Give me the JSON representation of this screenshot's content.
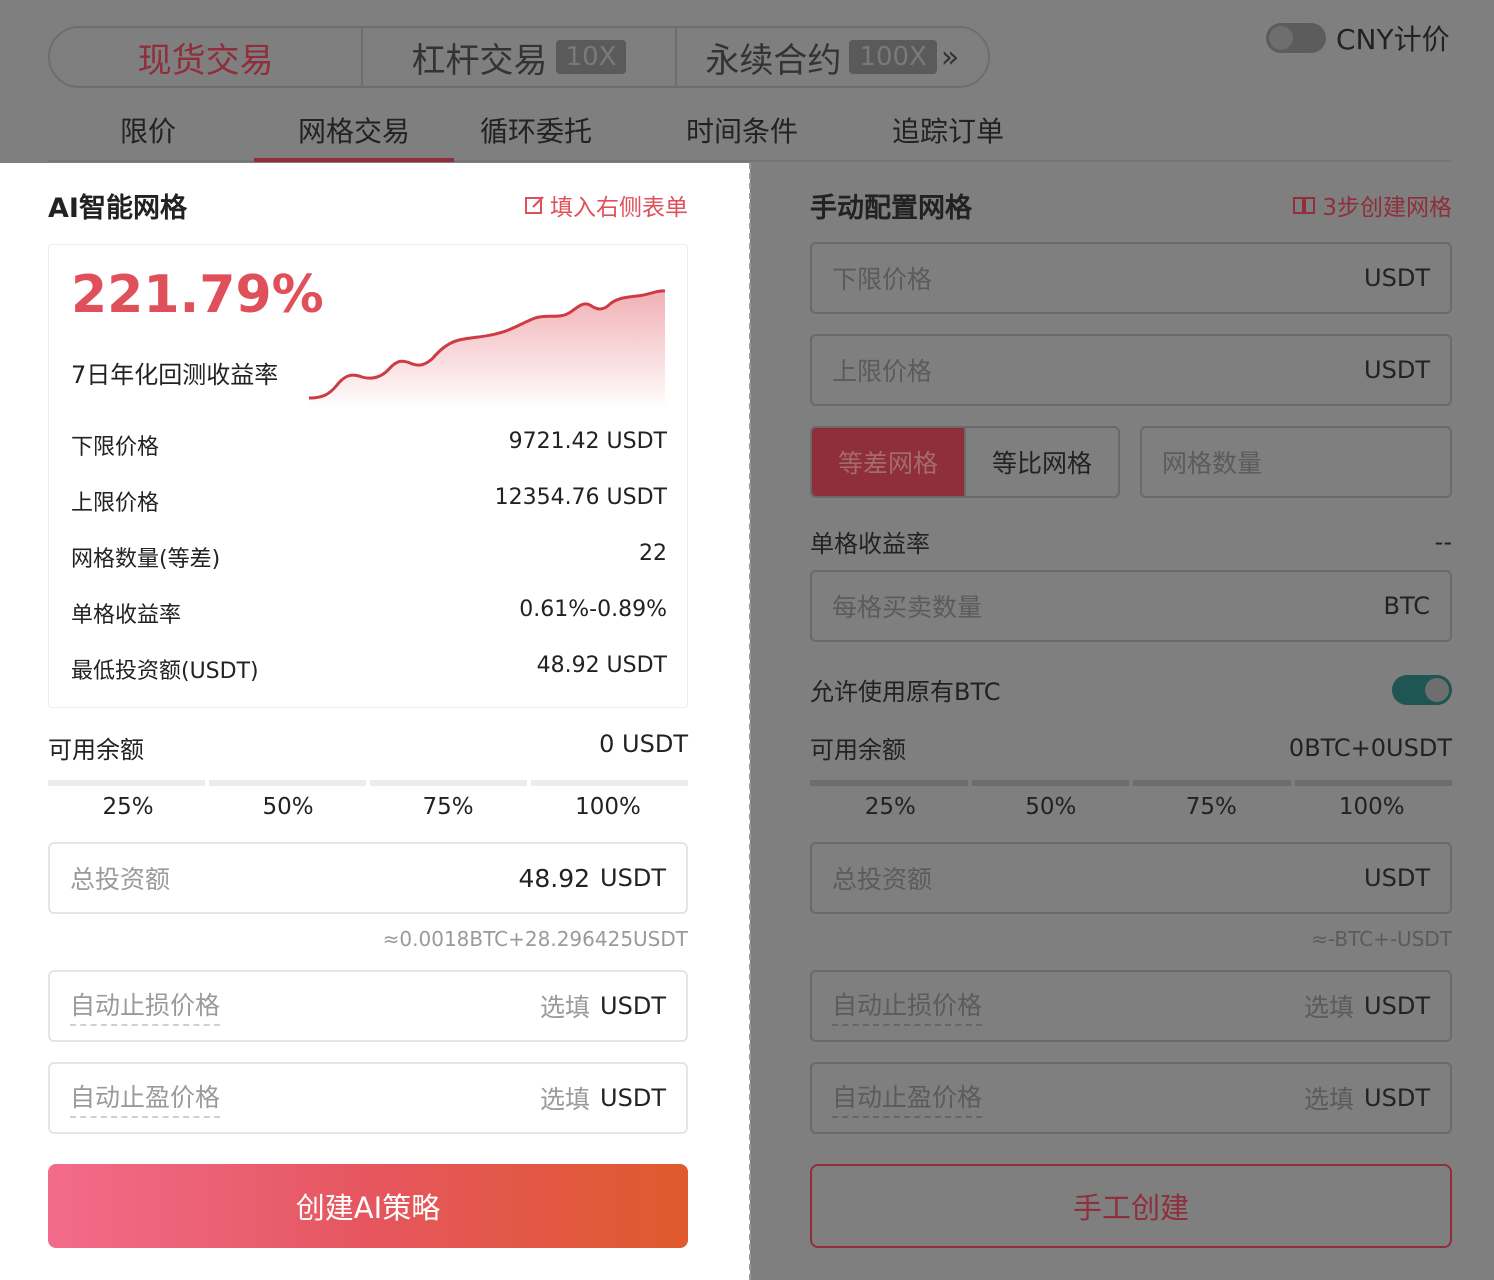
{
  "mode_tabs": [
    {
      "label": "现货交易",
      "badge": ""
    },
    {
      "label": "杠杆交易",
      "badge": "10X"
    },
    {
      "label": "永续合约",
      "badge": "100X"
    }
  ],
  "mode_more": "»",
  "cny_label": "CNY计价",
  "sub_tabs": [
    "限价",
    "网格交易",
    "循环委托",
    "时间条件",
    "追踪订单"
  ],
  "ai": {
    "title": "AI智能网格",
    "fill_link": "填入右侧表单",
    "yield": "221.79%",
    "yield_label": "7日年化回测收益率",
    "rows": [
      {
        "label": "下限价格",
        "value": "9721.42 USDT"
      },
      {
        "label": "上限价格",
        "value": "12354.76 USDT"
      },
      {
        "label": "网格数量(等差)",
        "value": "22"
      },
      {
        "label": "单格收益率",
        "value": "0.61%-0.89%"
      },
      {
        "label": "最低投资额(USDT)",
        "value": "48.92 USDT"
      }
    ],
    "avail_label": "可用余额",
    "avail_value": "0 USDT",
    "pcts": [
      "25%",
      "50%",
      "75%",
      "100%"
    ],
    "invest_ph": "总投资额",
    "invest_value": "48.92",
    "unit": "USDT",
    "approx": "≈0.0018BTC+28.296425USDT",
    "stop_loss": "自动止损价格",
    "take_profit": "自动止盈价格",
    "optional": "选填",
    "create": "创建AI策略"
  },
  "manual": {
    "title": "手动配置网格",
    "guide_link": "3步创建网格",
    "lower_ph": "下限价格",
    "upper_ph": "上限价格",
    "unit": "USDT",
    "grid_arith": "等差网格",
    "grid_geo": "等比网格",
    "grid_count_ph": "网格数量",
    "per_grid_label": "单格收益率",
    "per_grid_value": "--",
    "qty_ph": "每格买卖数量",
    "qty_unit": "BTC",
    "allow_label": "允许使用原有BTC",
    "avail_label": "可用余额",
    "avail_value": "0BTC+0USDT",
    "pcts": [
      "25%",
      "50%",
      "75%",
      "100%"
    ],
    "invest_ph": "总投资额",
    "approx": "≈-BTC+-USDT",
    "stop_loss": "自动止损价格",
    "take_profit": "自动止盈价格",
    "optional": "选填",
    "create": "手工创建"
  },
  "colors": {
    "accent": "#e0505a",
    "accent_dim": "#8e2f3b",
    "overlay": "#7f7f7f"
  }
}
